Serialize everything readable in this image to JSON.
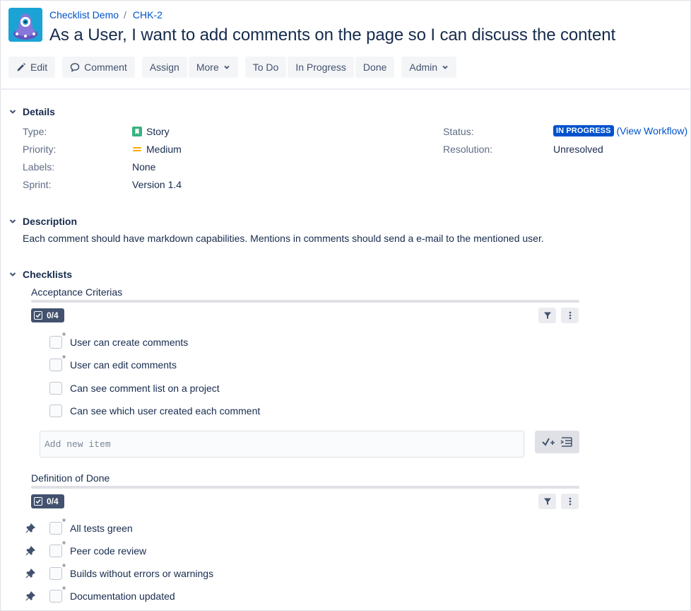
{
  "breadcrumb": {
    "project": "Checklist Demo",
    "separator": "/",
    "issue_key": "CHK-2"
  },
  "title": "As a User, I want to add comments on the page so I can discuss the content",
  "toolbar": {
    "edit": "Edit",
    "comment": "Comment",
    "assign": "Assign",
    "more": "More",
    "todo": "To Do",
    "in_progress": "In Progress",
    "done": "Done",
    "admin": "Admin"
  },
  "details": {
    "heading": "Details",
    "type_label": "Type:",
    "type_value": "Story",
    "priority_label": "Priority:",
    "priority_value": "Medium",
    "labels_label": "Labels:",
    "labels_value": "None",
    "sprint_label": "Sprint:",
    "sprint_value": "Version 1.4",
    "status_label": "Status:",
    "status_value": "IN PROGRESS",
    "workflow_link": "(View Workflow)",
    "resolution_label": "Resolution:",
    "resolution_value": "Unresolved"
  },
  "description": {
    "heading": "Description",
    "text": "Each comment should have markdown capabilities. Mentions in comments should send a e-mail to the mentioned user."
  },
  "checklists": {
    "heading": "Checklists",
    "acceptance": {
      "title": "Acceptance Criterias",
      "progress": "0/4",
      "items": [
        "User can create comments",
        "User can edit comments",
        "Can see comment list on a project",
        "Can see which user created each comment"
      ],
      "add_placeholder": "Add new item"
    },
    "dod": {
      "title": "Definition of Done",
      "progress": "0/4",
      "items": [
        "All tests green",
        "Peer code review",
        "Builds without errors or warnings",
        "Documentation updated"
      ]
    }
  },
  "colors": {
    "link": "#0052cc",
    "story_icon": "#36b37e",
    "priority_medium": "#ffab00",
    "status_lozenge": "#0052cc",
    "avatar_bg": "#1ba3d6"
  },
  "icons": {
    "edit": "pencil-icon",
    "comment": "speech-bubble-icon",
    "more": "chevron-down-icon",
    "filter": "filter-icon",
    "menu": "vertical-dots-icon",
    "pin": "pin-icon",
    "add_item": "add-checkmark-icon",
    "add_multi": "add-multiline-icon"
  }
}
